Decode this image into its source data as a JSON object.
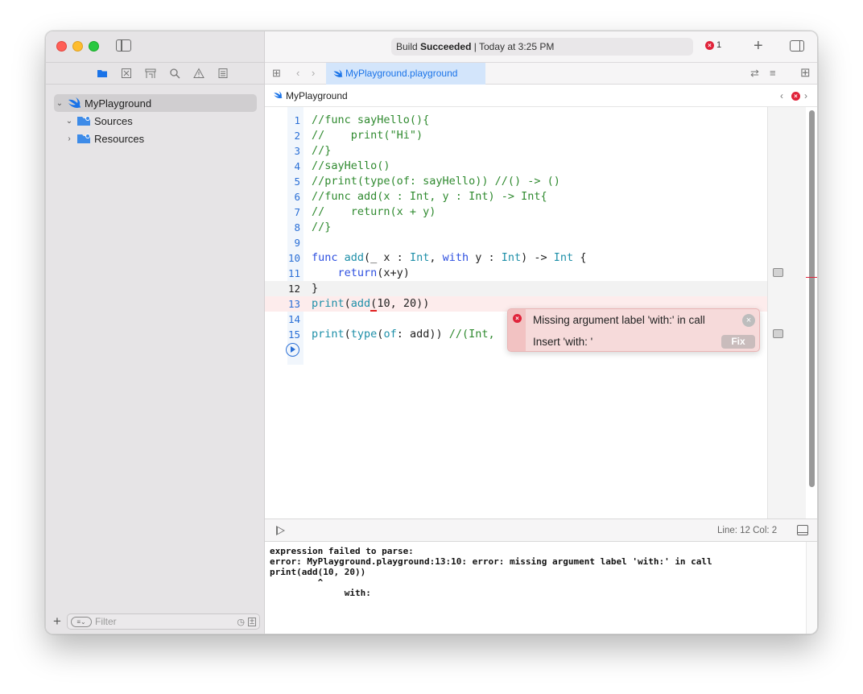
{
  "window": {
    "traffic_lights": [
      "close",
      "minimize",
      "zoom"
    ]
  },
  "toolbar": {
    "status_prefix": "Build ",
    "status_bold": "Succeeded",
    "status_suffix": " | Today at 3:25 PM",
    "error_count": "1"
  },
  "navigator": {
    "tree": [
      {
        "label": "MyPlayground",
        "expanded": true,
        "icon": "swift-icon"
      },
      {
        "label": "Sources",
        "expanded": true,
        "icon": "folder-icon"
      },
      {
        "label": "Resources",
        "expanded": false,
        "icon": "folder-icon"
      }
    ],
    "filter_placeholder": "Filter"
  },
  "tab": {
    "label": "MyPlayground.playground"
  },
  "jumpbar": {
    "label": "MyPlayground"
  },
  "code_lines": [
    {
      "n": "1",
      "text": "//func sayHello(){"
    },
    {
      "n": "2",
      "text": "//    print(\"Hi\")"
    },
    {
      "n": "3",
      "text": "//}"
    },
    {
      "n": "4",
      "text": "//sayHello()"
    },
    {
      "n": "5",
      "text": "//print(type(of: sayHello)) //() -> ()"
    },
    {
      "n": "6",
      "text": "//func add(x : Int, y : Int) -> Int{"
    },
    {
      "n": "7",
      "text": "//    return(x + y)"
    },
    {
      "n": "8",
      "text": "//}"
    },
    {
      "n": "9",
      "text": ""
    },
    {
      "n": "10",
      "text": "func add(_ x : Int, with y : Int) -> Int {"
    },
    {
      "n": "11",
      "text": "    return(x+y)"
    },
    {
      "n": "12",
      "text": "}"
    },
    {
      "n": "13",
      "text": "print(add(10, 20))"
    },
    {
      "n": "14",
      "text": ""
    },
    {
      "n": "15",
      "text": "print(type(of: add)) //(Int,"
    }
  ],
  "error_popup": {
    "message": "Missing argument label 'with:' in call",
    "fix_text": "Insert 'with: '",
    "fix_button": "Fix"
  },
  "debug_bar": {
    "position": "Line: 12  Col: 2"
  },
  "console": {
    "lines": [
      "expression failed to parse:",
      "error: MyPlayground.playground:13:10: error: missing argument label 'with:' in call",
      "print(add(10, 20))",
      "         ^",
      "              with: "
    ]
  },
  "colors": {
    "accent": "#1a73e8",
    "error": "#e0233a",
    "comment": "#2f8a2f",
    "keyword": "#2d4fe0",
    "type": "#1d8fa8"
  }
}
